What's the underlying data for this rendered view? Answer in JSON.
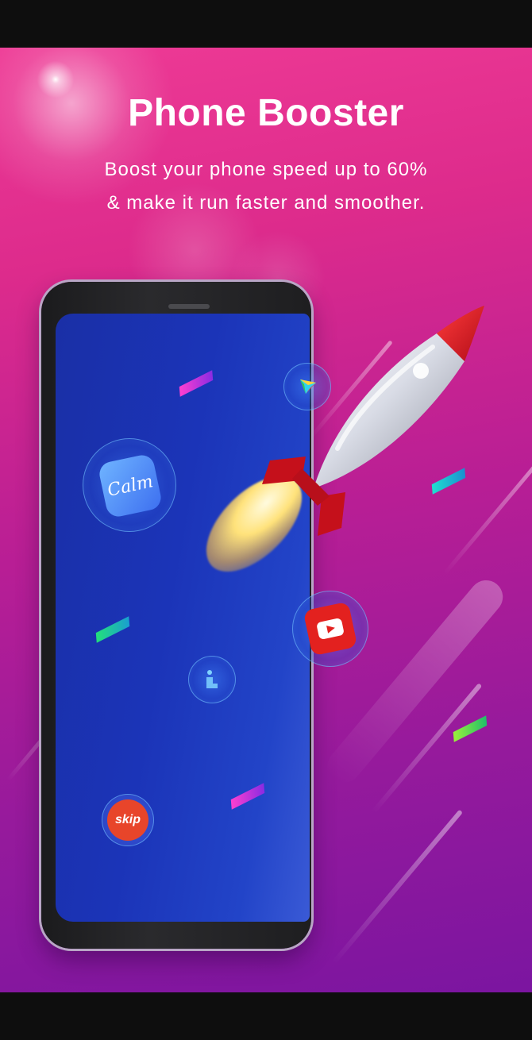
{
  "screen": {
    "title": "Phone Booster",
    "subtitle_line1": "Boost your phone speed up to 60%",
    "subtitle_line2": "& make it run faster and smoother."
  },
  "apps": {
    "calm": "Calm",
    "skip": "skip"
  },
  "icons": [
    "calm-app-icon",
    "youtube-app-icon",
    "play-store-icon",
    "app-icon",
    "skip-app-icon",
    "rocket-icon"
  ],
  "colors": {
    "background_top": "#ee3a95",
    "background_bottom": "#7b15a0",
    "screen_blue": "#1b34b8",
    "rocket_red": "#d8141f",
    "title_text": "#ffffff"
  }
}
